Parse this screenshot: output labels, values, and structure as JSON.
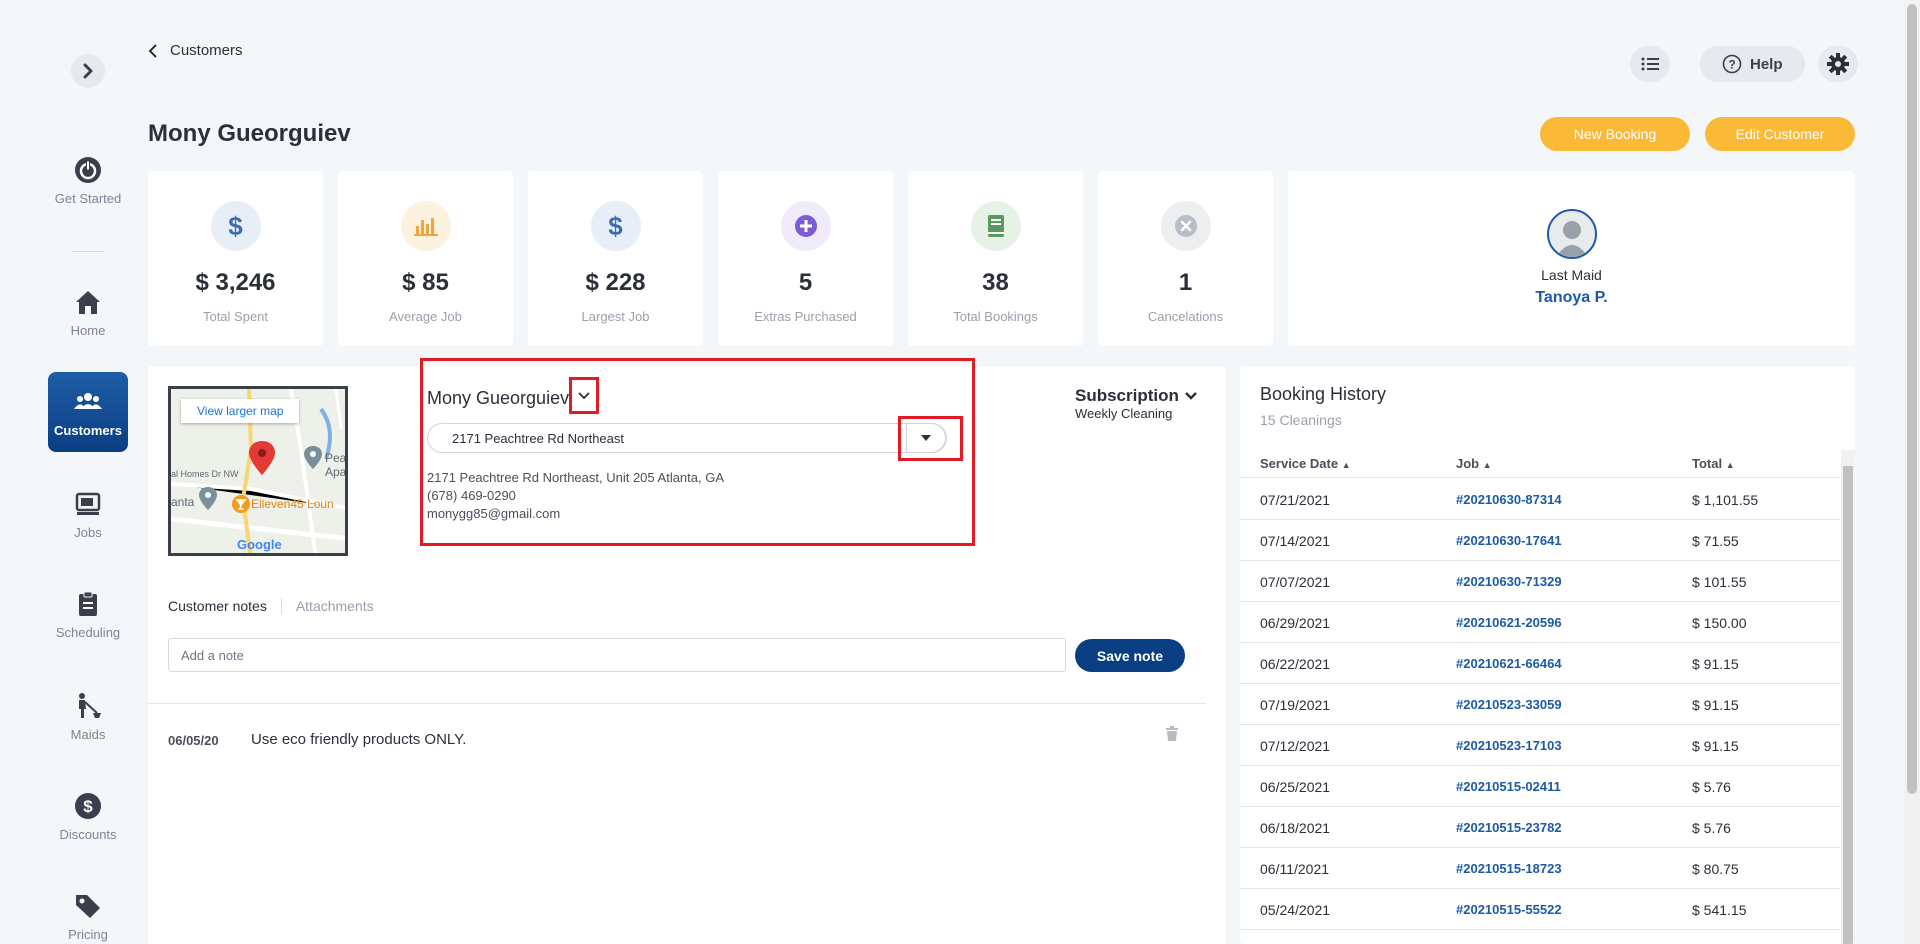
{
  "breadcrumb": {
    "label": "Customers"
  },
  "header": {
    "help_label": "Help",
    "title": "Mony Gueorguiev",
    "new_booking": "New Booking",
    "edit_customer": "Edit Customer"
  },
  "sidebar": {
    "items": [
      {
        "label": "Get Started",
        "icon": "power-icon"
      },
      {
        "label": "Home",
        "icon": "home-icon"
      },
      {
        "label": "Customers",
        "icon": "users-icon"
      },
      {
        "label": "Jobs",
        "icon": "jobs-icon"
      },
      {
        "label": "Scheduling",
        "icon": "clipboard-icon"
      },
      {
        "label": "Maids",
        "icon": "maid-icon"
      },
      {
        "label": "Discounts",
        "icon": "dollar-icon"
      },
      {
        "label": "Pricing",
        "icon": "tag-icon"
      }
    ]
  },
  "stats": [
    {
      "value": "$ 3,246",
      "label": "Total Spent",
      "color": "#3b6db3"
    },
    {
      "value": "$ 85",
      "label": "Average Job",
      "color": "#f2a53a"
    },
    {
      "value": "$ 228",
      "label": "Largest Job",
      "color": "#3b6db3"
    },
    {
      "value": "5",
      "label": "Extras Purchased",
      "color": "#7b5cd6"
    },
    {
      "value": "38",
      "label": "Total Bookings",
      "color": "#5a9a5e"
    },
    {
      "value": "1",
      "label": "Cancelations",
      "color": "#b9bec6"
    }
  ],
  "last_maid": {
    "label": "Last Maid",
    "name": "Tanoya P."
  },
  "map": {
    "button": "View larger map",
    "labels": [
      "Pea",
      "Apa",
      "Elleven45 Loun",
      "anta",
      "al Homes Dr NW",
      "Google"
    ]
  },
  "customer": {
    "name": "Mony Gueorguiev",
    "address_selected": "2171 Peachtree Rd Northeast",
    "full_address": "2171 Peachtree Rd Northeast, Unit 205 Atlanta, GA",
    "phone": "(678) 469-0290",
    "email": "monygg85@gmail.com"
  },
  "subscription": {
    "title": "Subscription",
    "plan": "Weekly Cleaning"
  },
  "notes": {
    "tab_notes": "Customer notes",
    "tab_attachments": "Attachments",
    "placeholder": "Add a note",
    "save_label": "Save note",
    "items": [
      {
        "date": "06/05/20",
        "text": "Use eco friendly products ONLY."
      }
    ]
  },
  "history": {
    "title": "Booking History",
    "subtitle": "15 Cleanings",
    "columns": [
      "Service Date",
      "Job",
      "Total"
    ],
    "rows": [
      {
        "date": "07/21/2021",
        "job": "#20210630-87314",
        "total": "$ 1,101.55"
      },
      {
        "date": "07/14/2021",
        "job": "#20210630-17641",
        "total": "$ 71.55"
      },
      {
        "date": "07/07/2021",
        "job": "#20210630-71329",
        "total": "$ 101.55"
      },
      {
        "date": "06/29/2021",
        "job": "#20210621-20596",
        "total": "$ 150.00"
      },
      {
        "date": "06/22/2021",
        "job": "#20210621-66464",
        "total": "$ 91.15"
      },
      {
        "date": "07/19/2021",
        "job": "#20210523-33059",
        "total": "$ 91.15"
      },
      {
        "date": "07/12/2021",
        "job": "#20210523-17103",
        "total": "$ 91.15"
      },
      {
        "date": "06/25/2021",
        "job": "#20210515-02411",
        "total": "$ 5.76"
      },
      {
        "date": "06/18/2021",
        "job": "#20210515-23782",
        "total": "$ 5.76"
      },
      {
        "date": "06/11/2021",
        "job": "#20210515-18723",
        "total": "$ 80.75"
      },
      {
        "date": "05/24/2021",
        "job": "#20210515-55522",
        "total": "$ 541.15"
      }
    ]
  }
}
